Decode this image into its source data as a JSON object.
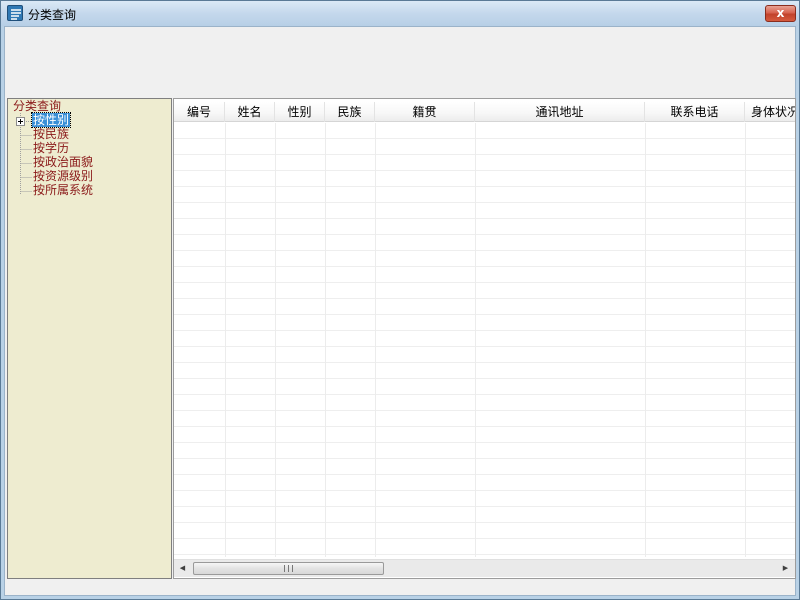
{
  "window": {
    "title": "分类查询",
    "close_label": "x"
  },
  "tree": {
    "root_label": "分类查询",
    "items": [
      {
        "label": "按性别",
        "selected": true
      },
      {
        "label": "按民族",
        "selected": false
      },
      {
        "label": "按学历",
        "selected": false
      },
      {
        "label": "按政治面貌",
        "selected": false
      },
      {
        "label": "按资源级别",
        "selected": false
      },
      {
        "label": "按所属系统",
        "selected": false
      }
    ]
  },
  "grid": {
    "columns": [
      "编号",
      "姓名",
      "性别",
      "民族",
      "籍贯",
      "通讯地址",
      "联系电话",
      "身体状况"
    ],
    "rows": []
  },
  "scrollbar": {
    "left_arrow": "◀",
    "right_arrow": "▶",
    "grip": "III"
  },
  "colors": {
    "tree_background": "#eeecd0",
    "tree_text": "#8b1a1a",
    "selection": "#3a8fd6",
    "close_button": "#c2432c"
  }
}
